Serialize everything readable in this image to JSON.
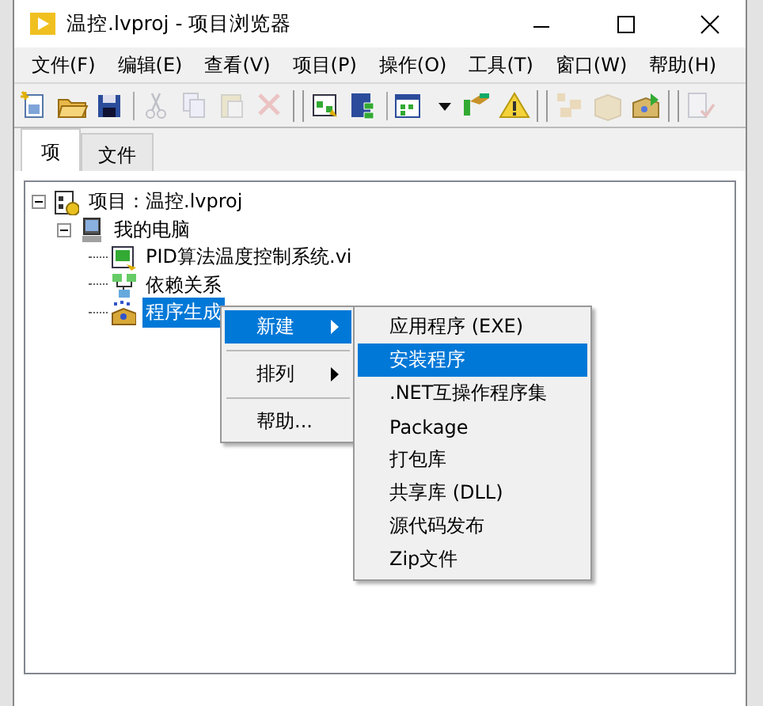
{
  "window": {
    "title": "温控.lvproj - 项目浏览器"
  },
  "menu_bar": [
    "文件(F)",
    "编辑(E)",
    "查看(V)",
    "项目(P)",
    "操作(O)",
    "工具(T)",
    "窗口(W)",
    "帮助(H)"
  ],
  "toolbar": [
    {
      "kind": "new",
      "disabled": false
    },
    {
      "kind": "open",
      "disabled": false
    },
    {
      "kind": "save",
      "disabled": false
    },
    {
      "kind": "sep"
    },
    {
      "kind": "cut",
      "disabled": true
    },
    {
      "kind": "copy",
      "disabled": true
    },
    {
      "kind": "paste",
      "disabled": true
    },
    {
      "kind": "delete",
      "disabled": true
    },
    {
      "kind": "group"
    },
    {
      "kind": "vi",
      "disabled": false
    },
    {
      "kind": "saveproj",
      "disabled": false
    },
    {
      "kind": "sep"
    },
    {
      "kind": "view",
      "disabled": false
    },
    {
      "kind": "dropdown",
      "disabled": false
    },
    {
      "kind": "hand",
      "disabled": false
    },
    {
      "kind": "warning",
      "disabled": false
    },
    {
      "kind": "group"
    },
    {
      "kind": "build",
      "disabled": true
    },
    {
      "kind": "box",
      "disabled": true
    },
    {
      "kind": "deploy",
      "disabled": false
    },
    {
      "kind": "group"
    },
    {
      "kind": "check",
      "disabled": true
    }
  ],
  "tabs": [
    {
      "label": "项",
      "selected": true
    },
    {
      "label": "文件",
      "selected": false
    }
  ],
  "tree": [
    {
      "label": "项目：温控.lvproj",
      "kind": "project",
      "expanded": true,
      "selected": false,
      "children": [
        {
          "label": "我的电脑",
          "kind": "computer",
          "expanded": true,
          "selected": false,
          "children": [
            {
              "label": "PID算法温度控制系统.vi",
              "kind": "vi",
              "selected": false
            },
            {
              "label": "依赖关系",
              "kind": "deps",
              "selected": false
            },
            {
              "label": "程序生成",
              "kind": "build",
              "selected": true
            }
          ]
        }
      ]
    }
  ],
  "context_menu": {
    "items": [
      {
        "label": "新建",
        "submenu": true,
        "selected": true
      },
      {
        "kind": "separator"
      },
      {
        "label": "排列",
        "submenu": true,
        "selected": false
      },
      {
        "kind": "separator"
      },
      {
        "label": "帮助...",
        "submenu": false,
        "selected": false
      }
    ],
    "submenu": [
      {
        "label": "应用程序 (EXE)",
        "selected": false
      },
      {
        "label": "安装程序",
        "selected": true
      },
      {
        "label": ".NET互操作程序集",
        "selected": false
      },
      {
        "label": "Package",
        "selected": false
      },
      {
        "label": "打包库",
        "selected": false
      },
      {
        "label": "共享库 (DLL)",
        "selected": false
      },
      {
        "label": "源代码发布",
        "selected": false
      },
      {
        "label": "Zip文件",
        "selected": false
      }
    ]
  }
}
